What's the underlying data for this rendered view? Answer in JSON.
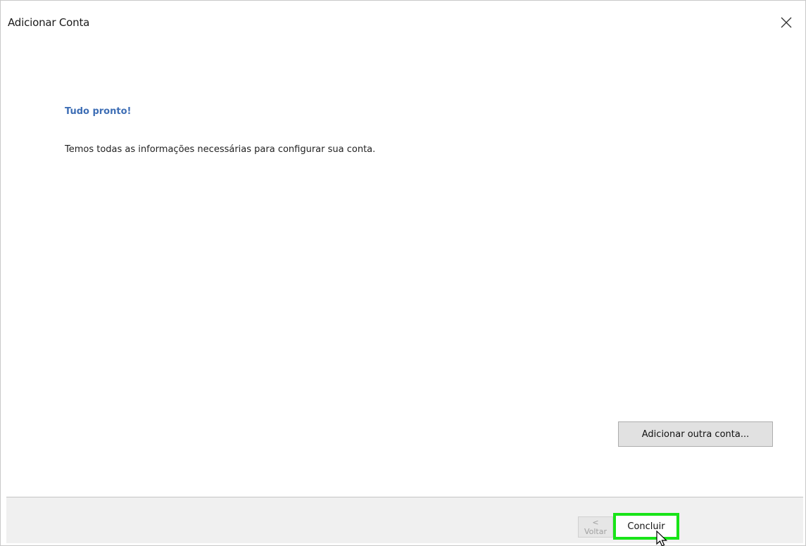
{
  "window": {
    "title": "Adicionar Conta",
    "close_icon": "close-icon"
  },
  "main": {
    "heading": "Tudo pronto!",
    "message": "Temos todas as informações necessárias para configurar sua conta.",
    "add_another_label": "Adicionar outra conta..."
  },
  "footer": {
    "back_label": "< Voltar",
    "finish_label": "Concluir",
    "finish_highlight_color": "#18e418"
  },
  "colors": {
    "heading": "#3e6eb5",
    "footer_bg": "#f0f0f0",
    "button_bg": "#e1e1e1"
  }
}
